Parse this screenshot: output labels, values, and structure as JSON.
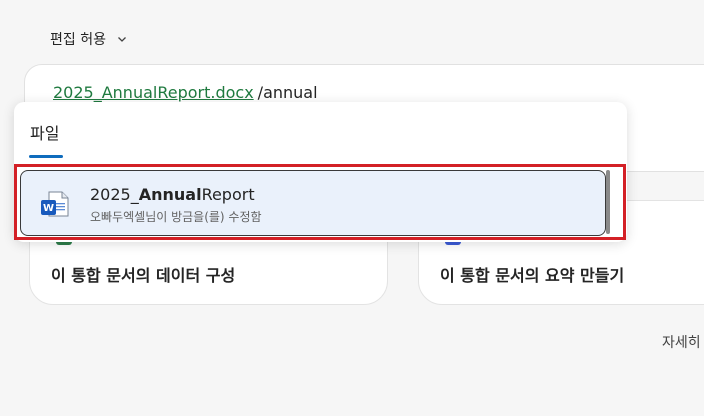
{
  "permission": {
    "label": "편집 허용"
  },
  "composer": {
    "file_reference": "2025_AnnualReport.docx",
    "command_text": "/annual"
  },
  "suggestions": [
    {
      "title": "이 통합 문서의 데이터 구성",
      "icon": "excel-icon"
    },
    {
      "title": "이 통합 문서의 요약 만들기",
      "icon": "document-icon"
    }
  ],
  "more_label": "자세히",
  "file_picker": {
    "tab_label": "파일",
    "results": [
      {
        "name_prefix": "2025_",
        "name_match": "Annual",
        "name_suffix": "Report",
        "subtitle": "오빠두엑셀님이 방금을(를) 수정함",
        "icon": "word-icon"
      }
    ]
  },
  "colors": {
    "highlight_border": "#d32026",
    "file_link": "#1f7a3f",
    "tab_accent": "#0f6cbd",
    "selected_item_bg": "#eaf1fb",
    "word_blue": "#185abd"
  }
}
